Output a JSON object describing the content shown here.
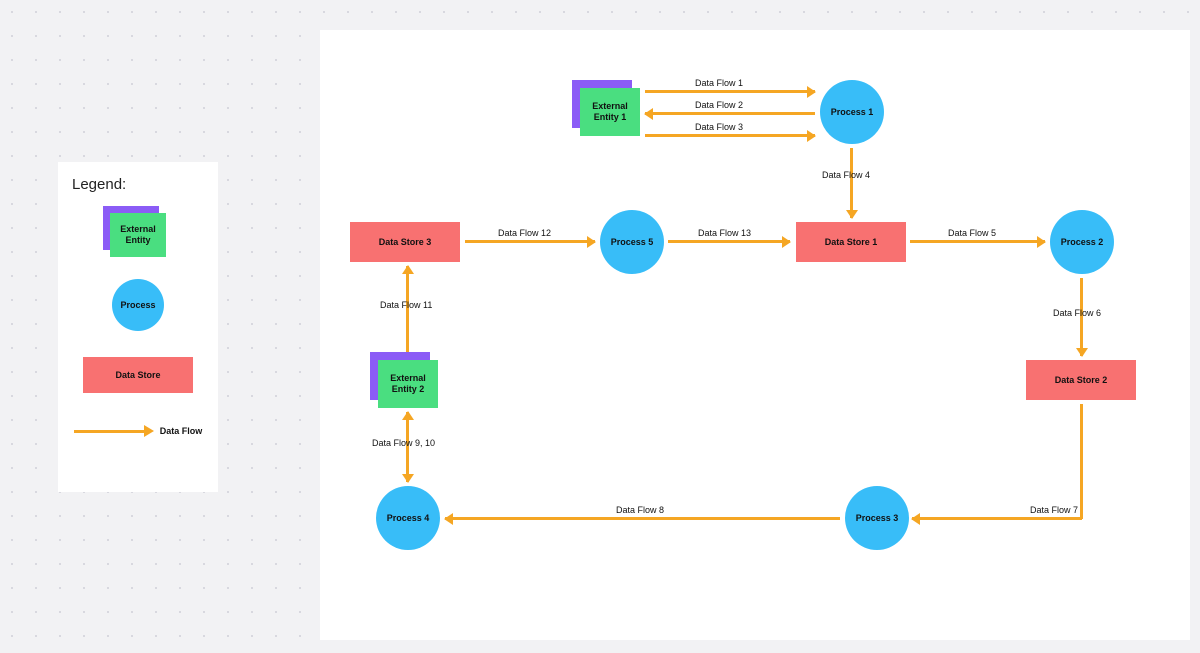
{
  "legend": {
    "title": "Legend:",
    "external_entity_label": "External\nEntity",
    "process_label": "Process",
    "datastore_label": "Data Store",
    "dataflow_label": "Data Flow"
  },
  "nodes": {
    "ext1": "External\nEntity 1",
    "ext2": "External\nEntity 2",
    "process1": "Process 1",
    "process2": "Process 2",
    "process3": "Process 3",
    "process4": "Process 4",
    "process5": "Process 5",
    "ds1": "Data Store 1",
    "ds2": "Data Store 2",
    "ds3": "Data Store 3"
  },
  "flows": {
    "f1": "Data Flow 1",
    "f2": "Data Flow 2",
    "f3": "Data Flow 3",
    "f4": "Data Flow 4",
    "f5": "Data Flow 5",
    "f6": "Data Flow 6",
    "f7": "Data Flow 7",
    "f8": "Data Flow 8",
    "f9_10": "Data Flow 9, 10",
    "f11": "Data Flow 11",
    "f12": "Data Flow 12",
    "f13": "Data Flow 13"
  },
  "chart_data": {
    "type": "diagram",
    "diagram_type": "data-flow-diagram",
    "nodes": [
      {
        "id": "ext1",
        "type": "external_entity",
        "label": "External Entity 1"
      },
      {
        "id": "ext2",
        "type": "external_entity",
        "label": "External Entity 2"
      },
      {
        "id": "p1",
        "type": "process",
        "label": "Process 1"
      },
      {
        "id": "p2",
        "type": "process",
        "label": "Process 2"
      },
      {
        "id": "p3",
        "type": "process",
        "label": "Process 3"
      },
      {
        "id": "p4",
        "type": "process",
        "label": "Process 4"
      },
      {
        "id": "p5",
        "type": "process",
        "label": "Process 5"
      },
      {
        "id": "ds1",
        "type": "data_store",
        "label": "Data Store 1"
      },
      {
        "id": "ds2",
        "type": "data_store",
        "label": "Data Store 2"
      },
      {
        "id": "ds3",
        "type": "data_store",
        "label": "Data Store 3"
      }
    ],
    "edges": [
      {
        "from": "ext1",
        "to": "p1",
        "label": "Data Flow 1"
      },
      {
        "from": "p1",
        "to": "ext1",
        "label": "Data Flow 2"
      },
      {
        "from": "ext1",
        "to": "p1",
        "label": "Data Flow 3"
      },
      {
        "from": "p1",
        "to": "ds1",
        "label": "Data Flow 4"
      },
      {
        "from": "ds1",
        "to": "p2",
        "label": "Data Flow 5"
      },
      {
        "from": "p2",
        "to": "ds2",
        "label": "Data Flow 6"
      },
      {
        "from": "ds2",
        "to": "p3",
        "label": "Data Flow 7"
      },
      {
        "from": "p3",
        "to": "p4",
        "label": "Data Flow 8"
      },
      {
        "from": "p4",
        "to": "ext2",
        "label": "Data Flow 9, 10",
        "bidirectional": true
      },
      {
        "from": "ext2",
        "to": "ds3",
        "label": "Data Flow 11"
      },
      {
        "from": "ds3",
        "to": "p5",
        "label": "Data Flow 12"
      },
      {
        "from": "p5",
        "to": "ds1",
        "label": "Data Flow 13"
      }
    ]
  }
}
